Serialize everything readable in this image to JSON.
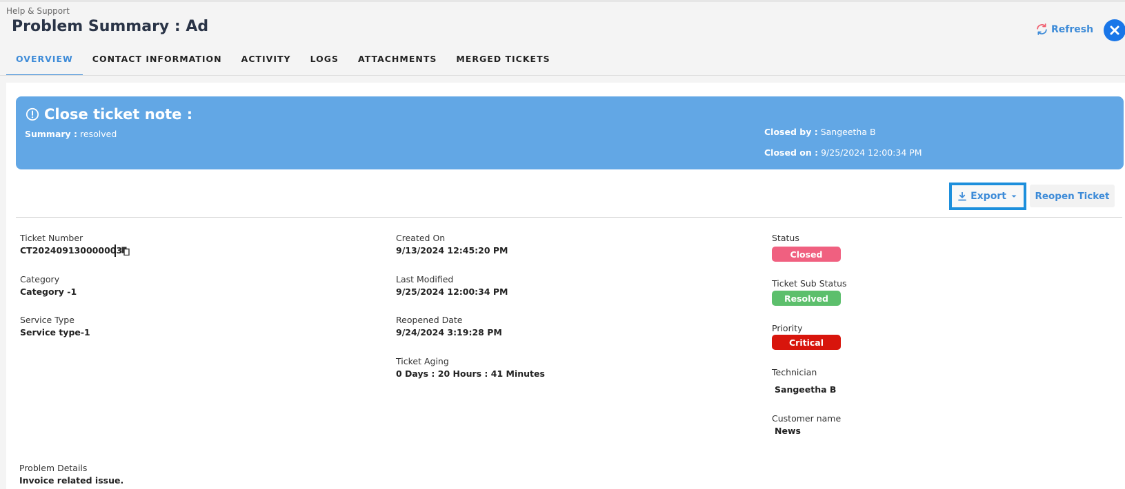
{
  "breadcrumb": "Help & Support",
  "page_title": "Problem Summary : Ad",
  "header": {
    "refresh_label": "Refresh"
  },
  "tabs": [
    {
      "label": "OVERVIEW"
    },
    {
      "label": "CONTACT INFORMATION"
    },
    {
      "label": "ACTIVITY"
    },
    {
      "label": "LOGS"
    },
    {
      "label": "ATTACHMENTS"
    },
    {
      "label": "MERGED TICKETS"
    }
  ],
  "close_note": {
    "title": "Close ticket note :",
    "summary_label": "Summary :",
    "summary_value": "resolved",
    "closed_by_label": "Closed by :",
    "closed_by_value": "Sangeetha B",
    "closed_on_label": "Closed on :",
    "closed_on_value": "9/25/2024 12:00:34 PM"
  },
  "actions": {
    "export_label": "Export",
    "reopen_label": "Reopen Ticket"
  },
  "fields": {
    "ticket_number": {
      "label": "Ticket Number",
      "value": "CT202409130000003"
    },
    "category": {
      "label": "Category",
      "value": "Category -1"
    },
    "service_type": {
      "label": "Service Type",
      "value": "Service type-1"
    },
    "created_on": {
      "label": "Created On",
      "value": "9/13/2024 12:45:20 PM"
    },
    "last_modified": {
      "label": "Last Modified",
      "value": "9/25/2024 12:00:34 PM"
    },
    "reopened_date": {
      "label": "Reopened Date",
      "value": "9/24/2024 3:19:28 PM"
    },
    "ticket_aging": {
      "label": "Ticket Aging",
      "value": "0 Days : 20 Hours : 41 Minutes"
    },
    "status": {
      "label": "Status",
      "value": "Closed"
    },
    "sub_status": {
      "label": "Ticket Sub Status",
      "value": "Resolved"
    },
    "priority": {
      "label": "Priority",
      "value": "Critical"
    },
    "technician": {
      "label": "Technician",
      "value": "Sangeetha B"
    },
    "customer_name": {
      "label": "Customer name",
      "value": "News"
    },
    "problem_details": {
      "label": "Problem Details",
      "value": "Invoice related issue."
    }
  },
  "colors": {
    "accent": "#3d8bd8",
    "banner": "#62a7e5",
    "status_closed": "#f06080",
    "status_resolved": "#5cbf6c",
    "priority_critical": "#d8150c",
    "export_highlight": "#1d8fdc"
  },
  "icons": {
    "refresh": "refresh-icon",
    "close": "close-icon",
    "alert": "alert-circle-icon",
    "download": "download-icon",
    "dropdown": "caret-down-icon",
    "copy": "copy-icon"
  }
}
